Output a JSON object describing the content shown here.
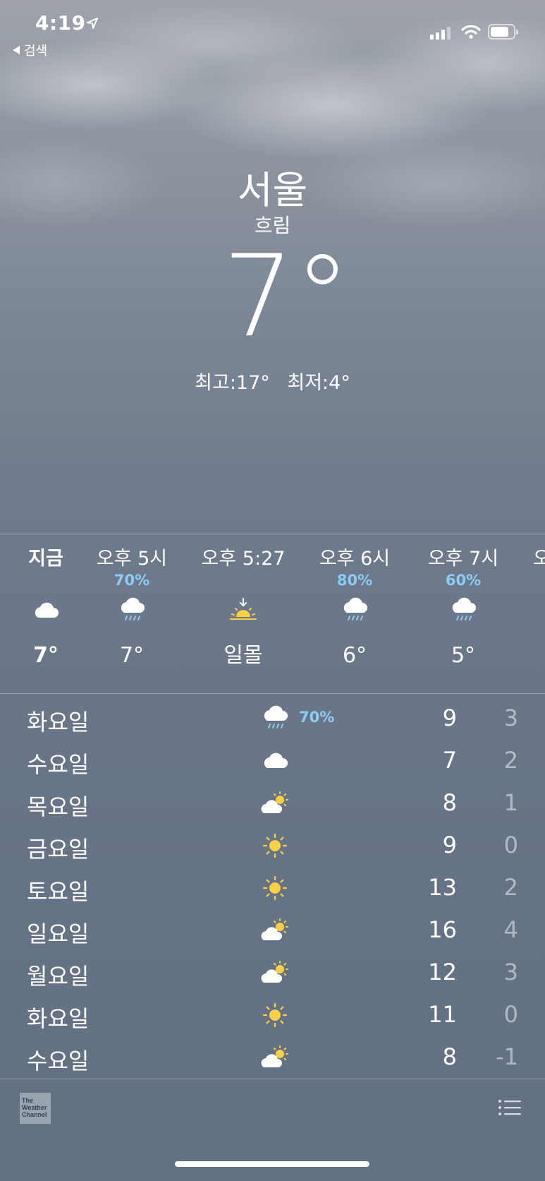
{
  "status_bar": {
    "time": "4:19",
    "back_label": "검색",
    "icons": [
      "location-arrow-icon",
      "cellular-signal-icon",
      "wifi-icon",
      "battery-icon"
    ]
  },
  "header": {
    "city": "서울",
    "condition": "흐림",
    "temperature": "7°",
    "high": "최고:17°",
    "low": "최저:4°"
  },
  "hourly": [
    {
      "label": "지금",
      "precip": "",
      "icon": "cloud-icon",
      "temp": "7°",
      "bold": true
    },
    {
      "label": "오후 5시",
      "precip": "70%",
      "icon": "rain-icon",
      "temp": "7°",
      "bold": false
    },
    {
      "label": "오후 5:27",
      "precip": "",
      "icon": "sunset-icon",
      "temp": "일몰",
      "bold": false
    },
    {
      "label": "오후 6시",
      "precip": "80%",
      "icon": "rain-icon",
      "temp": "6°",
      "bold": false
    },
    {
      "label": "오후 7시",
      "precip": "60%",
      "icon": "rain-icon",
      "temp": "5°",
      "bold": false
    },
    {
      "label": "오",
      "precip": "",
      "icon": "",
      "temp": "",
      "bold": false
    }
  ],
  "daily": [
    {
      "day": "화요일",
      "icon": "rain-icon",
      "precip": "70%",
      "high": "9",
      "low": "3"
    },
    {
      "day": "수요일",
      "icon": "cloud-icon",
      "precip": "",
      "high": "7",
      "low": "2"
    },
    {
      "day": "목요일",
      "icon": "partly-sunny-icon",
      "precip": "",
      "high": "8",
      "low": "1"
    },
    {
      "day": "금요일",
      "icon": "sun-icon",
      "precip": "",
      "high": "9",
      "low": "0"
    },
    {
      "day": "토요일",
      "icon": "sun-icon",
      "precip": "",
      "high": "13",
      "low": "2"
    },
    {
      "day": "일요일",
      "icon": "partly-sunny-icon",
      "precip": "",
      "high": "16",
      "low": "4"
    },
    {
      "day": "월요일",
      "icon": "partly-sunny-icon",
      "precip": "",
      "high": "12",
      "low": "3"
    },
    {
      "day": "화요일",
      "icon": "sun-icon",
      "precip": "",
      "high": "11",
      "low": "0"
    },
    {
      "day": "수요일",
      "icon": "partly-sunny-icon",
      "precip": "",
      "high": "8",
      "low": "-1"
    }
  ],
  "footer": {
    "logo_text": "The Weather Channel",
    "list_icon": "list-icon"
  },
  "colors": {
    "precip": "#8ccdf5",
    "sun": "#f7d046",
    "low_temp": "rgba(255,255,255,0.5)"
  }
}
